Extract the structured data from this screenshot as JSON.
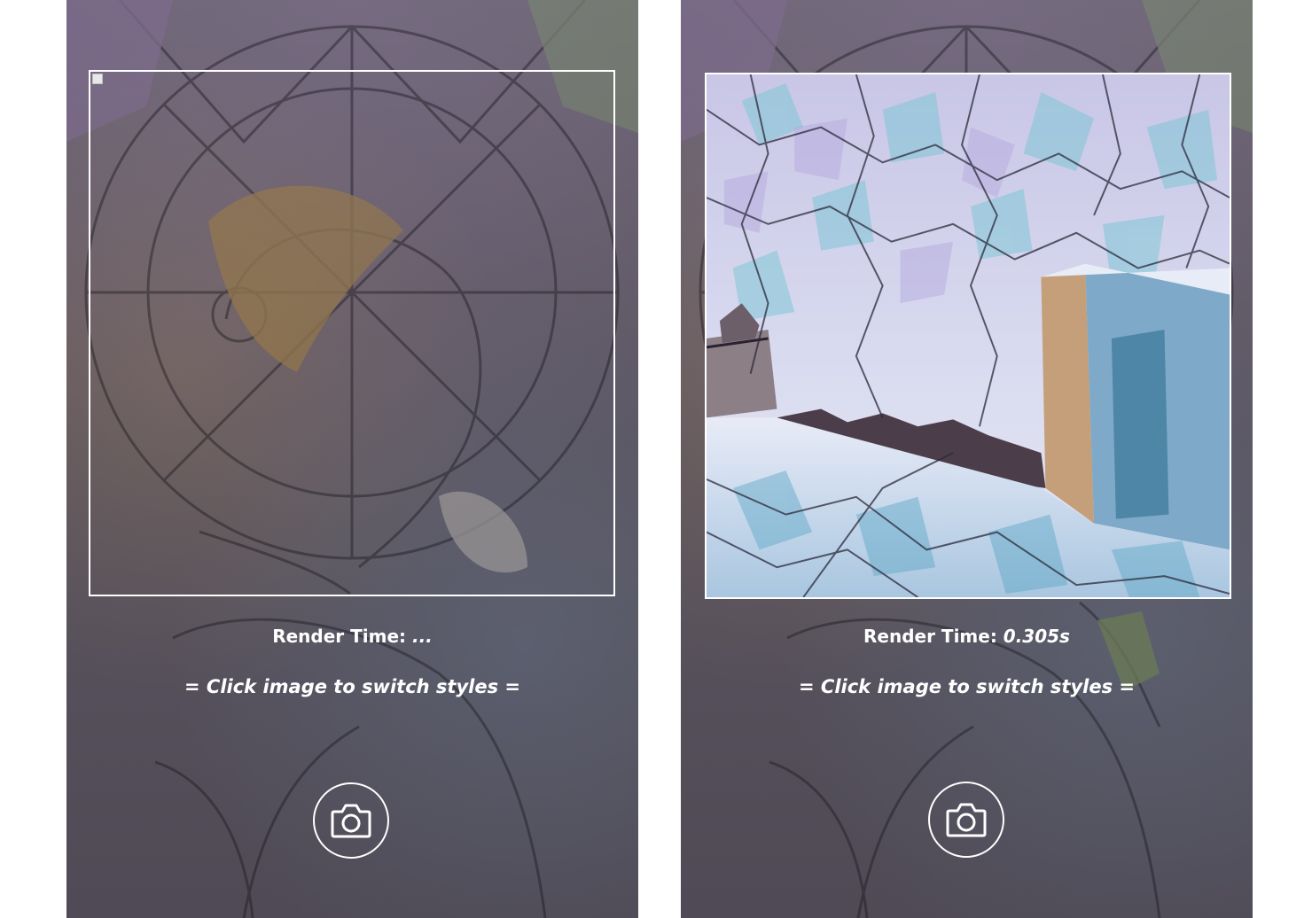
{
  "screens": [
    {
      "render_time_label": "Render Time:",
      "render_time_value": "...",
      "hint": "= Click image to switch styles =",
      "image_state": "broken",
      "camera_icon": "camera-icon"
    },
    {
      "render_time_label": "Render Time:",
      "render_time_value": "0.305s",
      "hint": "= Click image to switch styles =",
      "image_state": "stylized",
      "camera_icon": "camera-icon"
    }
  ],
  "colors": {
    "text": "#ffffff",
    "frame_border": "#ffffff",
    "overlay": "#5b5560"
  }
}
